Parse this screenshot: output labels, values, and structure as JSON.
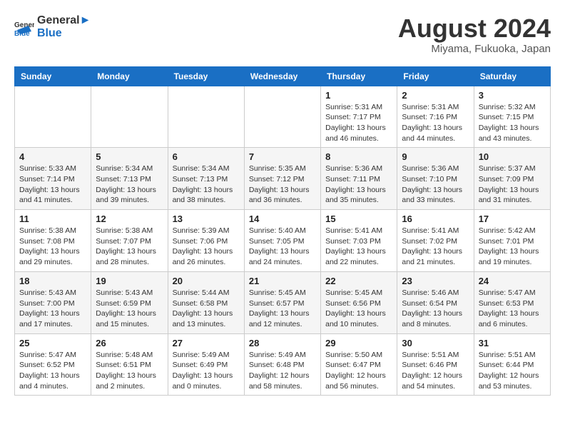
{
  "header": {
    "logo_line1": "General",
    "logo_line2": "Blue",
    "month_title": "August 2024",
    "location": "Miyama, Fukuoka, Japan"
  },
  "calendar": {
    "days_of_week": [
      "Sunday",
      "Monday",
      "Tuesday",
      "Wednesday",
      "Thursday",
      "Friday",
      "Saturday"
    ],
    "weeks": [
      [
        {
          "day": "",
          "info": ""
        },
        {
          "day": "",
          "info": ""
        },
        {
          "day": "",
          "info": ""
        },
        {
          "day": "",
          "info": ""
        },
        {
          "day": "1",
          "info": "Sunrise: 5:31 AM\nSunset: 7:17 PM\nDaylight: 13 hours and 46 minutes."
        },
        {
          "day": "2",
          "info": "Sunrise: 5:31 AM\nSunset: 7:16 PM\nDaylight: 13 hours and 44 minutes."
        },
        {
          "day": "3",
          "info": "Sunrise: 5:32 AM\nSunset: 7:15 PM\nDaylight: 13 hours and 43 minutes."
        }
      ],
      [
        {
          "day": "4",
          "info": "Sunrise: 5:33 AM\nSunset: 7:14 PM\nDaylight: 13 hours and 41 minutes."
        },
        {
          "day": "5",
          "info": "Sunrise: 5:34 AM\nSunset: 7:13 PM\nDaylight: 13 hours and 39 minutes."
        },
        {
          "day": "6",
          "info": "Sunrise: 5:34 AM\nSunset: 7:13 PM\nDaylight: 13 hours and 38 minutes."
        },
        {
          "day": "7",
          "info": "Sunrise: 5:35 AM\nSunset: 7:12 PM\nDaylight: 13 hours and 36 minutes."
        },
        {
          "day": "8",
          "info": "Sunrise: 5:36 AM\nSunset: 7:11 PM\nDaylight: 13 hours and 35 minutes."
        },
        {
          "day": "9",
          "info": "Sunrise: 5:36 AM\nSunset: 7:10 PM\nDaylight: 13 hours and 33 minutes."
        },
        {
          "day": "10",
          "info": "Sunrise: 5:37 AM\nSunset: 7:09 PM\nDaylight: 13 hours and 31 minutes."
        }
      ],
      [
        {
          "day": "11",
          "info": "Sunrise: 5:38 AM\nSunset: 7:08 PM\nDaylight: 13 hours and 29 minutes."
        },
        {
          "day": "12",
          "info": "Sunrise: 5:38 AM\nSunset: 7:07 PM\nDaylight: 13 hours and 28 minutes."
        },
        {
          "day": "13",
          "info": "Sunrise: 5:39 AM\nSunset: 7:06 PM\nDaylight: 13 hours and 26 minutes."
        },
        {
          "day": "14",
          "info": "Sunrise: 5:40 AM\nSunset: 7:05 PM\nDaylight: 13 hours and 24 minutes."
        },
        {
          "day": "15",
          "info": "Sunrise: 5:41 AM\nSunset: 7:03 PM\nDaylight: 13 hours and 22 minutes."
        },
        {
          "day": "16",
          "info": "Sunrise: 5:41 AM\nSunset: 7:02 PM\nDaylight: 13 hours and 21 minutes."
        },
        {
          "day": "17",
          "info": "Sunrise: 5:42 AM\nSunset: 7:01 PM\nDaylight: 13 hours and 19 minutes."
        }
      ],
      [
        {
          "day": "18",
          "info": "Sunrise: 5:43 AM\nSunset: 7:00 PM\nDaylight: 13 hours and 17 minutes."
        },
        {
          "day": "19",
          "info": "Sunrise: 5:43 AM\nSunset: 6:59 PM\nDaylight: 13 hours and 15 minutes."
        },
        {
          "day": "20",
          "info": "Sunrise: 5:44 AM\nSunset: 6:58 PM\nDaylight: 13 hours and 13 minutes."
        },
        {
          "day": "21",
          "info": "Sunrise: 5:45 AM\nSunset: 6:57 PM\nDaylight: 13 hours and 12 minutes."
        },
        {
          "day": "22",
          "info": "Sunrise: 5:45 AM\nSunset: 6:56 PM\nDaylight: 13 hours and 10 minutes."
        },
        {
          "day": "23",
          "info": "Sunrise: 5:46 AM\nSunset: 6:54 PM\nDaylight: 13 hours and 8 minutes."
        },
        {
          "day": "24",
          "info": "Sunrise: 5:47 AM\nSunset: 6:53 PM\nDaylight: 13 hours and 6 minutes."
        }
      ],
      [
        {
          "day": "25",
          "info": "Sunrise: 5:47 AM\nSunset: 6:52 PM\nDaylight: 13 hours and 4 minutes."
        },
        {
          "day": "26",
          "info": "Sunrise: 5:48 AM\nSunset: 6:51 PM\nDaylight: 13 hours and 2 minutes."
        },
        {
          "day": "27",
          "info": "Sunrise: 5:49 AM\nSunset: 6:49 PM\nDaylight: 13 hours and 0 minutes."
        },
        {
          "day": "28",
          "info": "Sunrise: 5:49 AM\nSunset: 6:48 PM\nDaylight: 12 hours and 58 minutes."
        },
        {
          "day": "29",
          "info": "Sunrise: 5:50 AM\nSunset: 6:47 PM\nDaylight: 12 hours and 56 minutes."
        },
        {
          "day": "30",
          "info": "Sunrise: 5:51 AM\nSunset: 6:46 PM\nDaylight: 12 hours and 54 minutes."
        },
        {
          "day": "31",
          "info": "Sunrise: 5:51 AM\nSunset: 6:44 PM\nDaylight: 12 hours and 53 minutes."
        }
      ]
    ]
  }
}
